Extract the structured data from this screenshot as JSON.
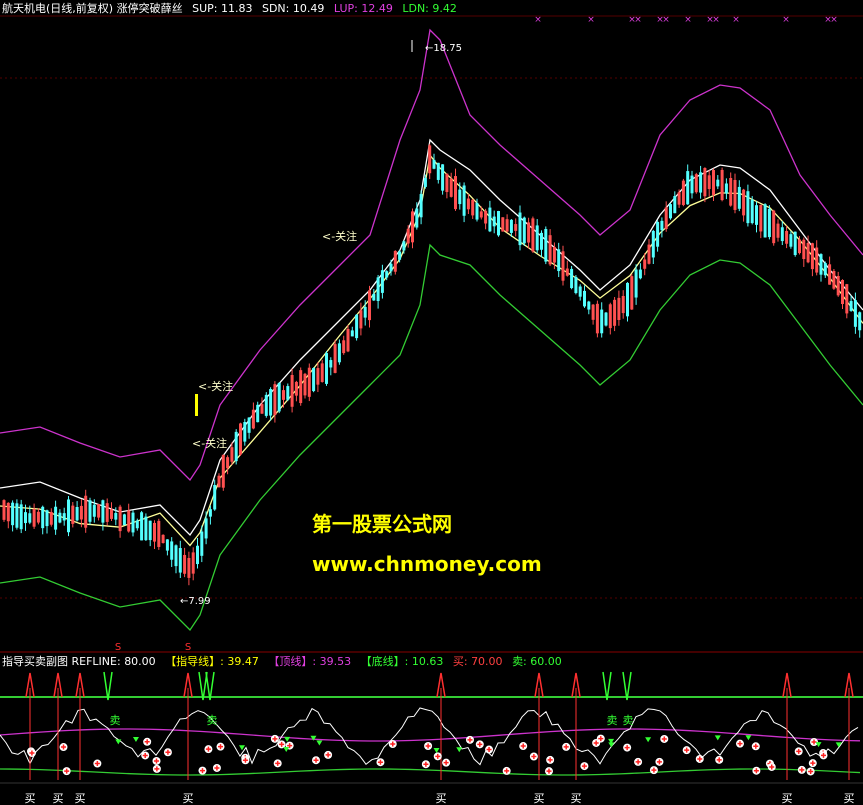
{
  "header": {
    "title": "航天机电(日线,前复权)",
    "indicator": "涨停突破薛丝",
    "sup_label": "SUP:",
    "sup_value": "11.83",
    "sdn_label": "SDN:",
    "sdn_value": "10.49",
    "lup_label": "LUP:",
    "lup_value": "12.49",
    "ldn_label": "LDN:",
    "ldn_value": "9.42"
  },
  "colors": {
    "bg": "#000000",
    "up_candle": "#ff5050",
    "down_candle": "#54ffff",
    "upper_band": "#cc33cc",
    "mid_band": "#ffffff",
    "low_band": "#33cc33",
    "ma_yellow": "#ffff99",
    "text_white": "#ffffff",
    "text_yellow": "#ffff00",
    "buy_arrow": "#ff3030",
    "sell_arrow": "#33ff33"
  },
  "annotations": {
    "high": "18.75",
    "low": "7.99",
    "focus": "关注"
  },
  "signals": {
    "s_marker": "S",
    "x_marker": "×",
    "buy_char": "买",
    "sell_char": "卖"
  },
  "sub_panel": {
    "name": "指导买卖副图",
    "refline_label": "REFLINE:",
    "refline_value": "80.00",
    "guide_label": "【指导线】:",
    "guide_value": "39.47",
    "top_label": "【顶线】:",
    "top_value": "39.53",
    "bottom_label": "【底线】:",
    "bottom_value": "10.63",
    "buy_label": "买:",
    "buy_value": "70.00",
    "sell_label": "卖:",
    "sell_value": "60.00"
  },
  "watermark": {
    "line1": "第一股票公式网",
    "line2": "www.chnmoney.com"
  }
}
